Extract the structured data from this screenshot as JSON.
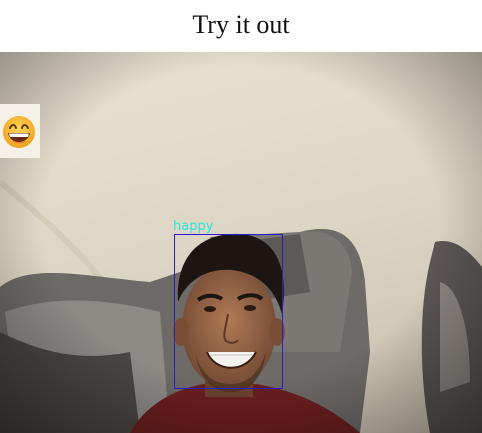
{
  "page": {
    "title": "Try it out"
  },
  "camera_feed": {
    "detection": {
      "label": "happy",
      "box_color": "#2a1bd6",
      "label_color": "#27e8e0"
    },
    "emotion_emoji": "grinning-face-emoji"
  }
}
